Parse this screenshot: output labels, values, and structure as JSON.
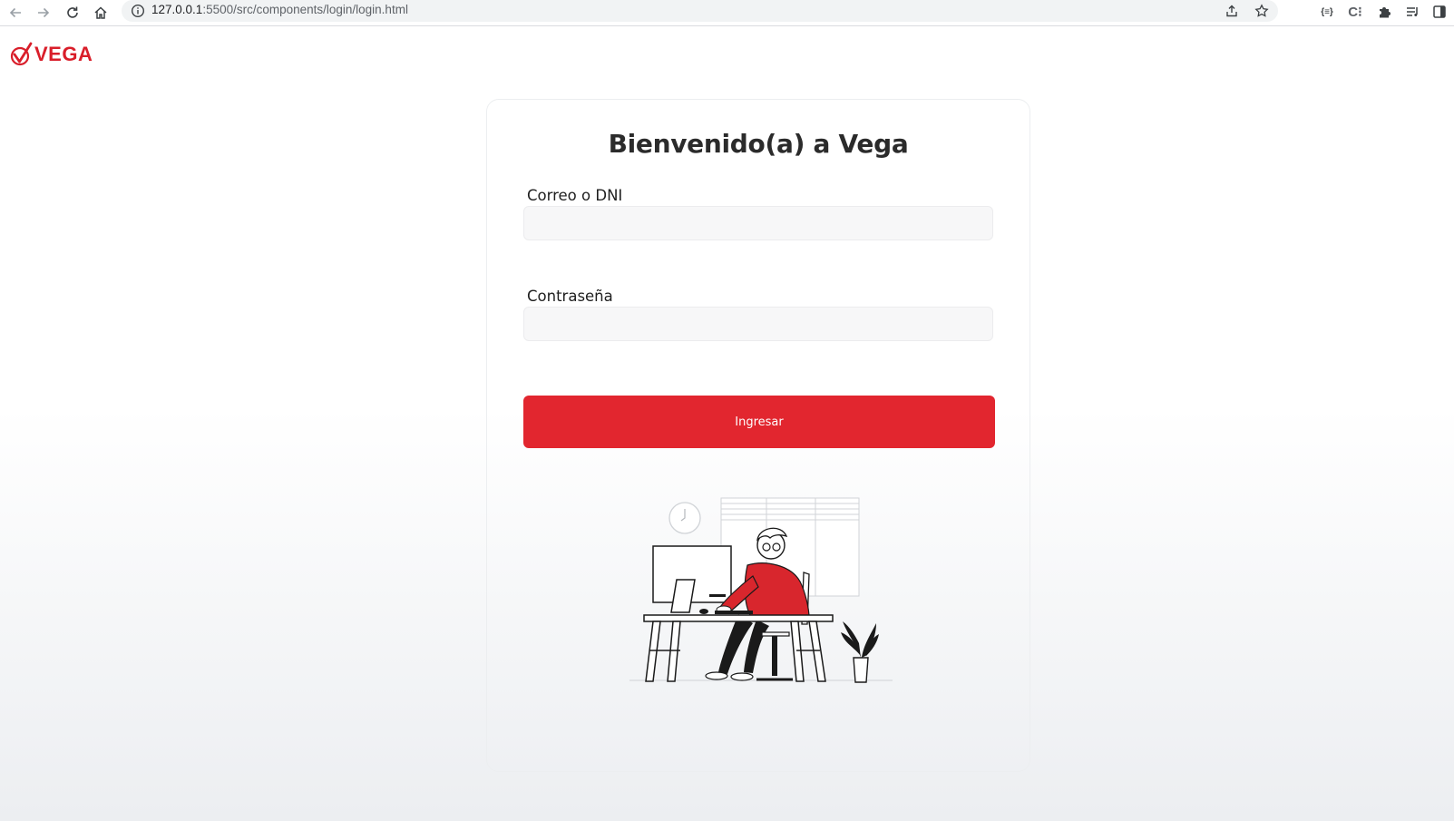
{
  "browser": {
    "url_host": "127.0.0.1",
    "url_rest": ":5500/src/components/login/login.html"
  },
  "page": {
    "logo_text": "VEGA",
    "title": "Bienvenido(a) a Vega",
    "fields": {
      "user_label": "Correo o DNI",
      "user_value": "",
      "password_label": "Contraseña",
      "password_value": ""
    },
    "submit_label": "Ingresar"
  },
  "colors": {
    "brand_red": "#e2262f",
    "logo_red": "#d91e2a",
    "title": "#2b2b2b"
  },
  "icons": {
    "back": "arrow-left-icon",
    "forward": "arrow-right-icon",
    "reload": "reload-icon",
    "home": "home-icon",
    "site_info": "info-icon",
    "share": "share-icon",
    "bookmark": "star-icon",
    "extensions": "puzzle-icon",
    "reading_list": "reading-list-icon",
    "side_panel": "side-panel-icon"
  }
}
